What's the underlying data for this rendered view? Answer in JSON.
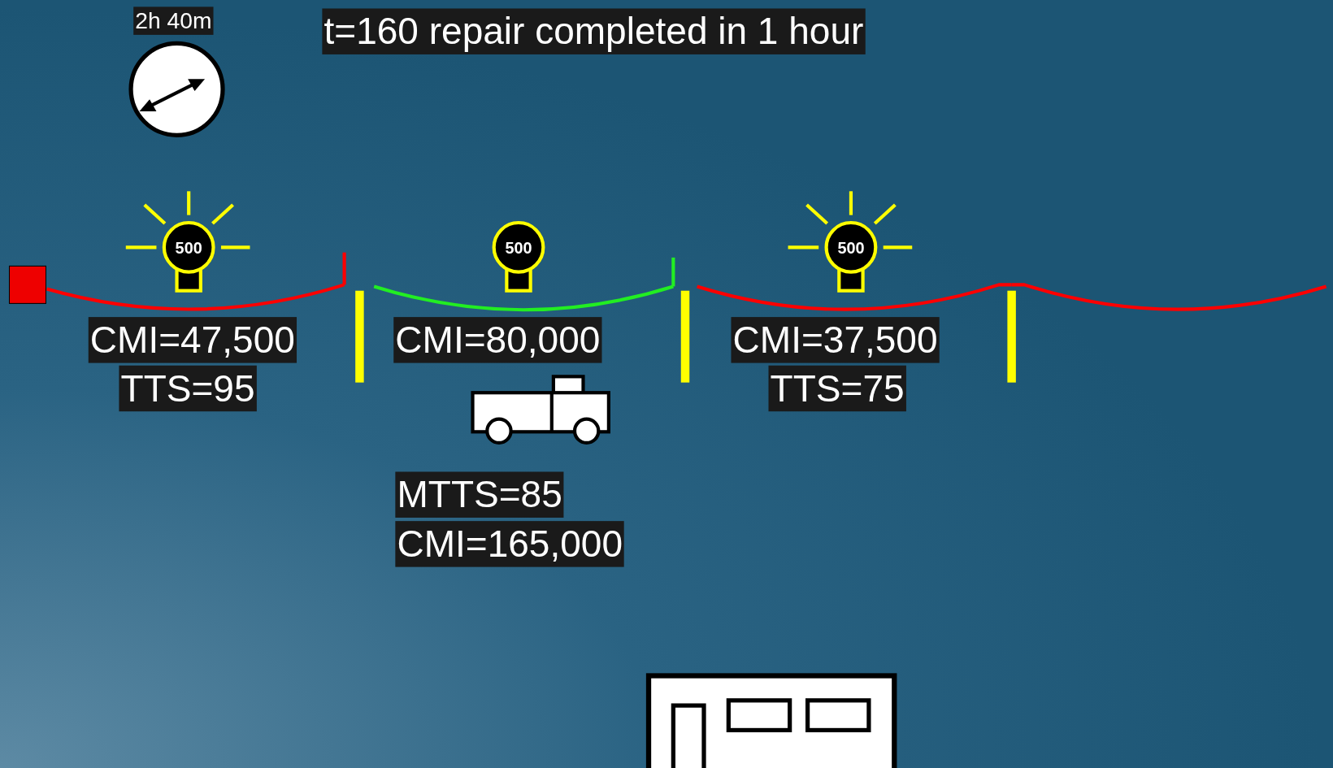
{
  "clock": {
    "label": "2h 40m"
  },
  "title": "t=160 repair completed in 1 hour",
  "segments": [
    {
      "color": "#ff0000",
      "end_tick": true
    },
    {
      "color": "#22ee22",
      "end_tick": true
    },
    {
      "color": "#ff0000",
      "end_tick": false
    },
    {
      "color": "#ff0000",
      "end_tick": false
    }
  ],
  "sections": [
    {
      "bulb": {
        "label": "500",
        "lit": true
      },
      "labels": [
        "CMI=47,500",
        "TTS=95"
      ]
    },
    {
      "bulb": {
        "label": "500",
        "lit": false
      },
      "labels": [
        "CMI=80,000"
      ]
    },
    {
      "bulb": {
        "label": "500",
        "lit": true
      },
      "labels": [
        "CMI=37,500",
        "TTS=75"
      ]
    }
  ],
  "crew": {
    "labels": [
      "MTTS=85",
      "CMI=165,000"
    ]
  }
}
